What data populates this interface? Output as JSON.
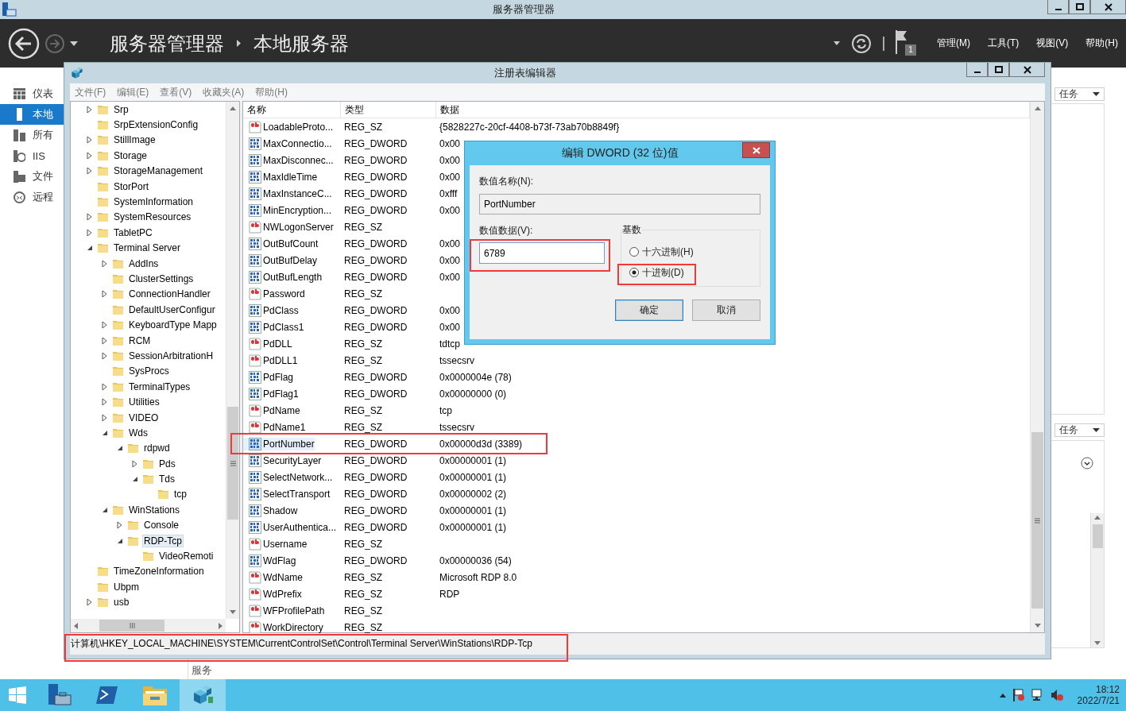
{
  "server_manager": {
    "window_title": "服务器管理器",
    "breadcrumb": [
      "服务器管理器",
      "本地服务器"
    ],
    "notification_count": "1",
    "menus": [
      "管理(M)",
      "工具(T)",
      "视图(V)",
      "帮助(H)"
    ],
    "nav": [
      {
        "kind": "dashboard",
        "label": "仪表",
        "selected": false
      },
      {
        "kind": "server",
        "label": "本地",
        "selected": true
      },
      {
        "kind": "servers",
        "label": "所有",
        "selected": false
      },
      {
        "kind": "iis",
        "label": "IIS",
        "selected": false
      },
      {
        "kind": "files",
        "label": "文件",
        "selected": false
      },
      {
        "kind": "remote",
        "label": "远程",
        "selected": false
      }
    ],
    "task_buttons": [
      "任务",
      "任务"
    ],
    "section_heading": "服务"
  },
  "regedit": {
    "title": "注册表编辑器",
    "menu": [
      "文件(F)",
      "编辑(E)",
      "查看(V)",
      "收藏夹(A)",
      "帮助(H)"
    ],
    "tree": [
      {
        "name": "Srp",
        "expanded": false,
        "selected": false
      },
      {
        "name": "SrpExtensionConfig",
        "selected": false
      },
      {
        "name": "StillImage",
        "expanded": false,
        "selected": false
      },
      {
        "name": "Storage",
        "expanded": false,
        "selected": false
      },
      {
        "name": "StorageManagement",
        "expanded": false,
        "selected": false
      },
      {
        "name": "StorPort",
        "selected": false
      },
      {
        "name": "SystemInformation",
        "selected": false
      },
      {
        "name": "SystemResources",
        "expanded": false,
        "selected": false
      },
      {
        "name": "TabletPC",
        "expanded": false,
        "selected": false
      },
      {
        "name": "Terminal Server",
        "expanded": true,
        "selected": false,
        "children": [
          {
            "name": "AddIns",
            "expanded": false,
            "selected": false
          },
          {
            "name": "ClusterSettings",
            "selected": false
          },
          {
            "name": "ConnectionHandler",
            "expanded": false,
            "selected": false
          },
          {
            "name": "DefaultUserConfigur",
            "selected": false
          },
          {
            "name": "KeyboardType Mapp",
            "expanded": false,
            "selected": false
          },
          {
            "name": "RCM",
            "expanded": false,
            "selected": false
          },
          {
            "name": "SessionArbitrationH",
            "expanded": false,
            "selected": false
          },
          {
            "name": "SysProcs",
            "selected": false
          },
          {
            "name": "TerminalTypes",
            "expanded": false,
            "selected": false
          },
          {
            "name": "Utilities",
            "expanded": false,
            "selected": false
          },
          {
            "name": "VIDEO",
            "expanded": false,
            "selected": false
          },
          {
            "name": "Wds",
            "expanded": true,
            "selected": false,
            "children": [
              {
                "name": "rdpwd",
                "expanded": true,
                "selected": false,
                "children": [
                  {
                    "name": "Pds",
                    "expanded": false,
                    "selected": false
                  },
                  {
                    "name": "Tds",
                    "expanded": true,
                    "selected": false,
                    "children": [
                      {
                        "name": "tcp",
                        "selected": false
                      }
                    ]
                  }
                ]
              }
            ]
          },
          {
            "name": "WinStations",
            "expanded": true,
            "selected": false,
            "children": [
              {
                "name": "Console",
                "expanded": false,
                "selected": false
              },
              {
                "name": "RDP-Tcp",
                "expanded": true,
                "selected": true,
                "children": [
                  {
                    "name": "VideoRemoti",
                    "selected": false
                  }
                ]
              }
            ]
          }
        ]
      },
      {
        "name": "TimeZoneInformation",
        "selected": false
      },
      {
        "name": "Ubpm",
        "selected": false
      },
      {
        "name": "usb",
        "expanded": false,
        "selected": false
      }
    ],
    "columns": [
      "名称",
      "类型",
      "数据"
    ],
    "rows": [
      {
        "kind": "sz",
        "name": "LoadableProto...",
        "type": "REG_SZ",
        "data": "{5828227c-20cf-4408-b73f-73ab70b8849f}",
        "selected": false
      },
      {
        "kind": "dword",
        "name": "MaxConnectio...",
        "type": "REG_DWORD",
        "data": "0x00",
        "selected": false
      },
      {
        "kind": "dword",
        "name": "MaxDisconnec...",
        "type": "REG_DWORD",
        "data": "0x00",
        "selected": false
      },
      {
        "kind": "dword",
        "name": "MaxIdleTime",
        "type": "REG_DWORD",
        "data": "0x00",
        "selected": false
      },
      {
        "kind": "dword",
        "name": "MaxInstanceC...",
        "type": "REG_DWORD",
        "data": "0xfff",
        "selected": false
      },
      {
        "kind": "dword",
        "name": "MinEncryption...",
        "type": "REG_DWORD",
        "data": "0x00",
        "selected": false
      },
      {
        "kind": "sz",
        "name": "NWLogonServer",
        "type": "REG_SZ",
        "selected": false
      },
      {
        "kind": "dword",
        "name": "OutBufCount",
        "type": "REG_DWORD",
        "data": "0x00",
        "selected": false
      },
      {
        "kind": "dword",
        "name": "OutBufDelay",
        "type": "REG_DWORD",
        "data": "0x00",
        "selected": false
      },
      {
        "kind": "dword",
        "name": "OutBufLength",
        "type": "REG_DWORD",
        "data": "0x00",
        "selected": false
      },
      {
        "kind": "sz",
        "name": "Password",
        "type": "REG_SZ",
        "selected": false
      },
      {
        "kind": "dword",
        "name": "PdClass",
        "type": "REG_DWORD",
        "data": "0x00",
        "selected": false
      },
      {
        "kind": "dword",
        "name": "PdClass1",
        "type": "REG_DWORD",
        "data": "0x00",
        "selected": false
      },
      {
        "kind": "sz",
        "name": "PdDLL",
        "type": "REG_SZ",
        "data": "tdtcp",
        "selected": false
      },
      {
        "kind": "sz",
        "name": "PdDLL1",
        "type": "REG_SZ",
        "data": "tssecsrv",
        "selected": false
      },
      {
        "kind": "dword",
        "name": "PdFlag",
        "type": "REG_DWORD",
        "data": "0x0000004e (78)",
        "selected": false
      },
      {
        "kind": "dword",
        "name": "PdFlag1",
        "type": "REG_DWORD",
        "data": "0x00000000 (0)",
        "selected": false
      },
      {
        "kind": "sz",
        "name": "PdName",
        "type": "REG_SZ",
        "data": "tcp",
        "selected": false
      },
      {
        "kind": "sz",
        "name": "PdName1",
        "type": "REG_SZ",
        "data": "tssecsrv",
        "selected": false
      },
      {
        "kind": "dword",
        "name": "PortNumber",
        "type": "REG_DWORD",
        "data": "0x00000d3d (3389)",
        "selected": true
      },
      {
        "kind": "dword",
        "name": "SecurityLayer",
        "type": "REG_DWORD",
        "data": "0x00000001 (1)",
        "selected": false
      },
      {
        "kind": "dword",
        "name": "SelectNetwork...",
        "type": "REG_DWORD",
        "data": "0x00000001 (1)",
        "selected": false
      },
      {
        "kind": "dword",
        "name": "SelectTransport",
        "type": "REG_DWORD",
        "data": "0x00000002 (2)",
        "selected": false
      },
      {
        "kind": "dword",
        "name": "Shadow",
        "type": "REG_DWORD",
        "data": "0x00000001 (1)",
        "selected": false
      },
      {
        "kind": "dword",
        "name": "UserAuthentica...",
        "type": "REG_DWORD",
        "data": "0x00000001 (1)",
        "selected": false
      },
      {
        "kind": "sz",
        "name": "Username",
        "type": "REG_SZ",
        "selected": false
      },
      {
        "kind": "dword",
        "name": "WdFlag",
        "type": "REG_DWORD",
        "data": "0x00000036 (54)",
        "selected": false
      },
      {
        "kind": "sz",
        "name": "WdName",
        "type": "REG_SZ",
        "data": "Microsoft RDP 8.0",
        "selected": false
      },
      {
        "kind": "sz",
        "name": "WdPrefix",
        "type": "REG_SZ",
        "data": "RDP",
        "selected": false
      },
      {
        "kind": "sz",
        "name": "WFProfilePath",
        "type": "REG_SZ",
        "selected": false
      },
      {
        "kind": "sz",
        "name": "WorkDirectory",
        "type": "REG_SZ",
        "selected": false
      }
    ],
    "status_path": "计算机\\HKEY_LOCAL_MACHINE\\SYSTEM\\CurrentControlSet\\Control\\Terminal Server\\WinStations\\RDP-Tcp"
  },
  "dialog": {
    "title": "编辑 DWORD (32 位)值",
    "name_label": "数值名称(N):",
    "name_value": "PortNumber",
    "data_label": "数值数据(V):",
    "data_value": "6789",
    "base_label": "基数",
    "bases": [
      {
        "label": "十六进制(H)",
        "selected": false
      },
      {
        "label": "十进制(D)",
        "selected": true
      }
    ],
    "buttons": [
      "确定",
      "取消"
    ]
  },
  "taskbar": {
    "apps": [
      {
        "kind": "server-manager",
        "active": false
      },
      {
        "kind": "powershell",
        "active": false
      },
      {
        "kind": "explorer",
        "active": false
      },
      {
        "kind": "regedit",
        "active": true
      }
    ],
    "time": "18:12",
    "date": "2022/7/21"
  }
}
